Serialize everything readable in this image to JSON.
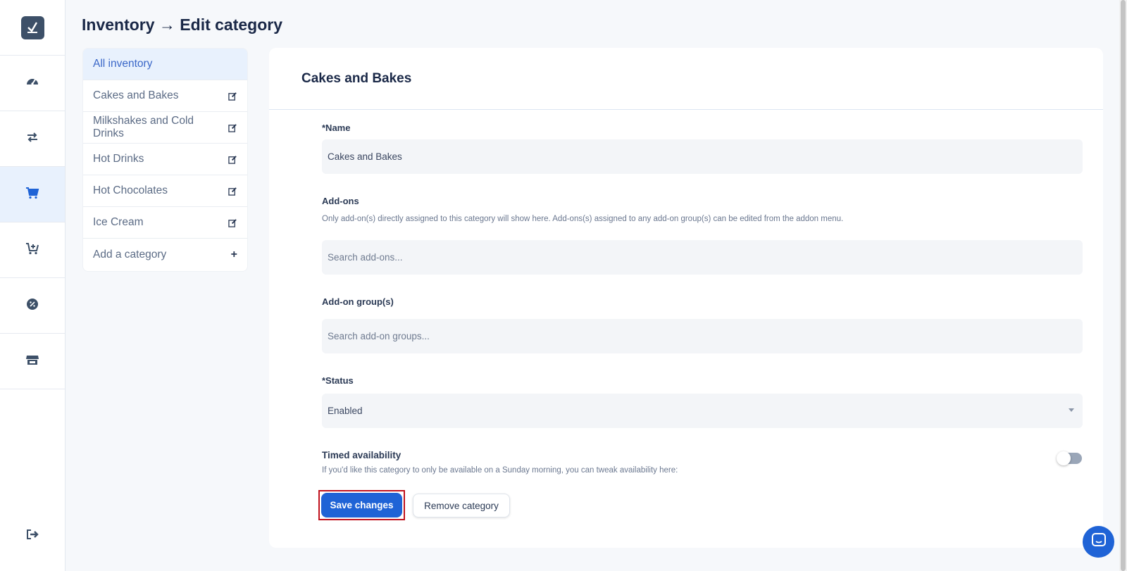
{
  "page": {
    "title": "Inventory → Edit category"
  },
  "nav_rail": {
    "items": [
      {
        "icon": "dashboard-gauge-icon"
      },
      {
        "icon": "transfer-arrows-icon"
      },
      {
        "icon": "cart-icon",
        "active": true
      },
      {
        "icon": "cart-plus-icon"
      },
      {
        "icon": "discount-badge-icon"
      },
      {
        "icon": "store-icon"
      }
    ],
    "logout_icon": "logout-icon"
  },
  "categories": {
    "all_label": "All inventory",
    "items": [
      {
        "label": "Cakes and Bakes",
        "icon": "edit-icon"
      },
      {
        "label": "Milkshakes and Cold Drinks",
        "icon": "edit-icon"
      },
      {
        "label": "Hot Drinks",
        "icon": "edit-icon"
      },
      {
        "label": "Hot Chocolates",
        "icon": "edit-icon"
      },
      {
        "label": "Ice Cream",
        "icon": "edit-icon"
      }
    ],
    "add_label": "Add a category",
    "add_icon": "+"
  },
  "form": {
    "header": "Cakes and Bakes",
    "name": {
      "label": "*Name",
      "value": "Cakes and Bakes"
    },
    "addons": {
      "label": "Add-ons",
      "help": "Only add-on(s) directly assigned to this category will show here. Add-ons(s) assigned to any add-on group(s) can be edited from the addon menu.",
      "placeholder": "Search add-ons..."
    },
    "addon_groups": {
      "label": "Add-on group(s)",
      "placeholder": "Search add-on groups..."
    },
    "status": {
      "label": "*Status",
      "value": "Enabled"
    },
    "timed": {
      "label": "Timed availability",
      "help": "If you'd like this category to only be available on a Sunday morning, you can tweak availability here:",
      "enabled": false
    },
    "save_label": "Save changes",
    "remove_label": "Remove category"
  },
  "colors": {
    "accent": "#1f63d6",
    "active_bg": "#e8f1fd",
    "highlight_border": "#c0121d"
  }
}
